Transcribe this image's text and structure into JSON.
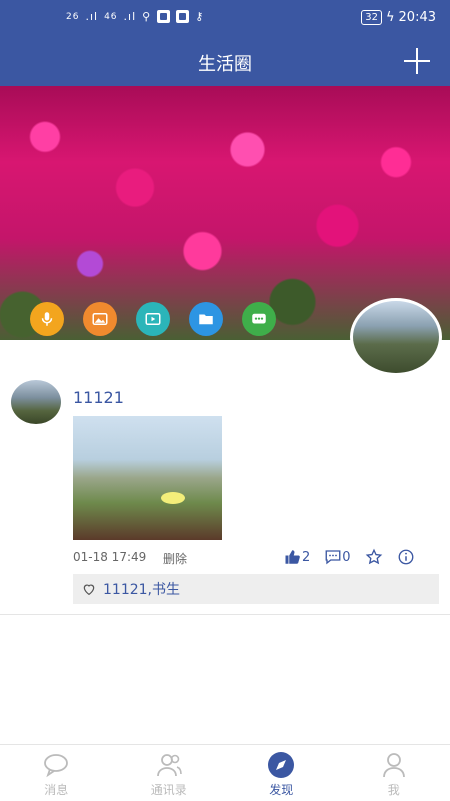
{
  "status_bar": {
    "signal_1": "26",
    "signal_2": "46",
    "battery": "32",
    "time": "20:43"
  },
  "header": {
    "title": "生活圈"
  },
  "cover_actions": [
    {
      "name": "voice",
      "icon": "microphone-icon",
      "color": "#f3a51e"
    },
    {
      "name": "image",
      "icon": "image-icon",
      "color": "#f08a2e"
    },
    {
      "name": "video",
      "icon": "play-icon",
      "color": "#2bb5b9"
    },
    {
      "name": "file",
      "icon": "folder-icon",
      "color": "#2d95e3"
    },
    {
      "name": "text",
      "icon": "chat-dots-icon",
      "color": "#3fae4a"
    }
  ],
  "post": {
    "username": "11121",
    "time": "01-18 17:49",
    "delete_label": "删除",
    "like_count": "2",
    "comment_count": "0",
    "liked_by": "11121,书生"
  },
  "tabs": [
    {
      "label": "消息",
      "icon": "chat-bubble-icon",
      "active": false
    },
    {
      "label": "通讯录",
      "icon": "contacts-icon",
      "active": false
    },
    {
      "label": "发现",
      "icon": "compass-icon",
      "active": true
    },
    {
      "label": "我",
      "icon": "person-icon",
      "active": false
    }
  ],
  "colors": {
    "primary": "#3b57a2",
    "muted": "#bbbbbb"
  }
}
